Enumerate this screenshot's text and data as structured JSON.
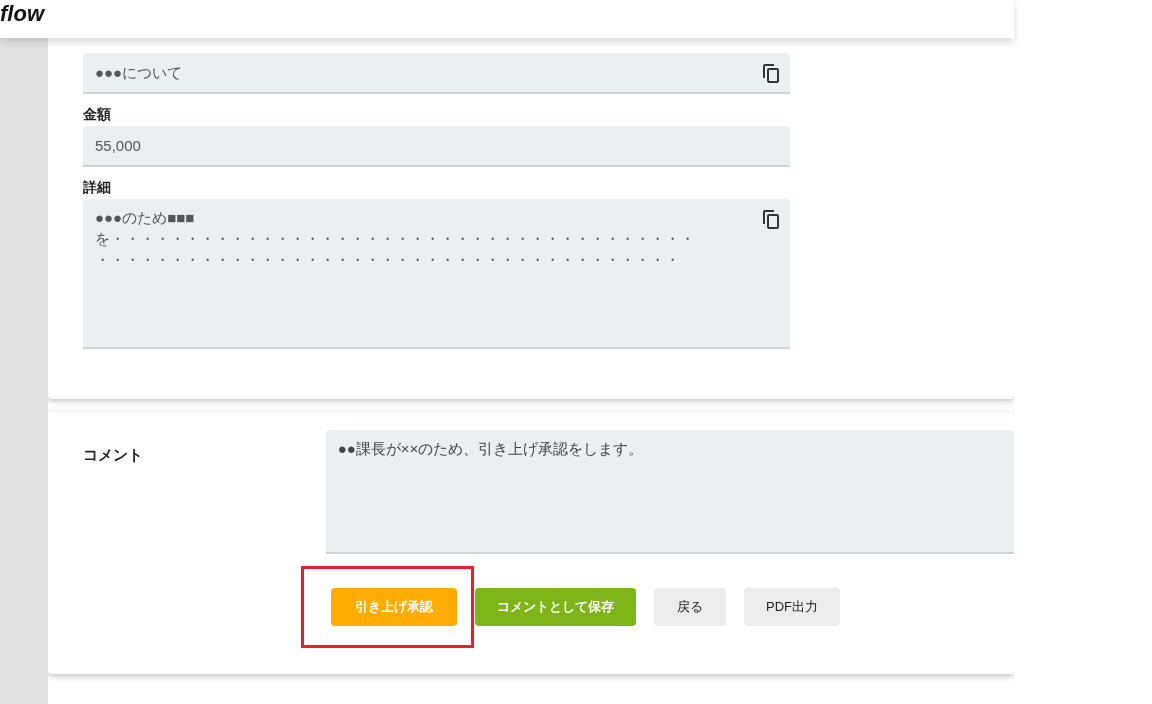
{
  "header": {
    "logo": "flow"
  },
  "fields": [
    {
      "value": "●●●について",
      "copyable": true,
      "kind": "line"
    },
    {
      "label": "金額",
      "value": "55,000",
      "copyable": false,
      "kind": "line"
    },
    {
      "label": "詳細",
      "lines": [
        "●●●のため■■■",
        "を・・・・・・・・・・・・・・・・・・・・・・・・・・・・・・・・・・・・・・・",
        "・・・・・・・・・・・・・・・・・・・・・・・・・・・・・・・・・・・・・・・"
      ],
      "copyable": true,
      "kind": "area"
    }
  ],
  "comment": {
    "label": "コメント",
    "value": "●●課長が××のため、引き上げ承認をします。"
  },
  "buttons": [
    {
      "label": "引き上げ承認",
      "kind": "filled",
      "color": "#ffab00",
      "highlighted": true
    },
    {
      "label": "コメントとして保存",
      "kind": "filled",
      "color": "#7fb419",
      "highlighted": false
    },
    {
      "label": "戻る",
      "kind": "plain",
      "color": "#ececec",
      "highlighted": false
    },
    {
      "label": "PDF出力",
      "kind": "plain",
      "color": "#ececec",
      "highlighted": false
    }
  ]
}
